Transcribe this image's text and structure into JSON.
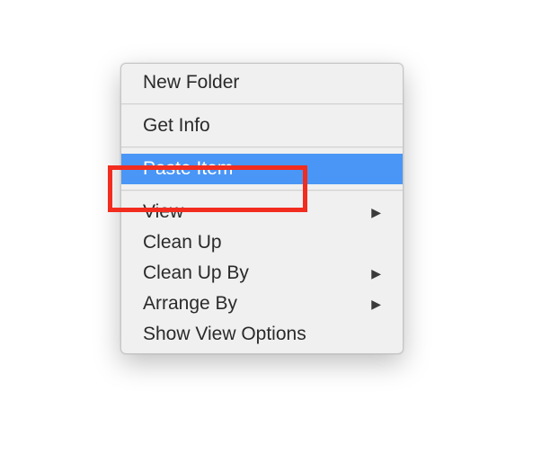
{
  "menu": {
    "items": [
      {
        "label": "New Folder",
        "has_submenu": false
      },
      {
        "label": "Get Info",
        "has_submenu": false
      },
      {
        "label": "Paste Item",
        "has_submenu": false
      },
      {
        "label": "View",
        "has_submenu": true
      },
      {
        "label": "Clean Up",
        "has_submenu": false
      },
      {
        "label": "Clean Up By",
        "has_submenu": true
      },
      {
        "label": "Arrange By",
        "has_submenu": true
      },
      {
        "label": "Show View Options",
        "has_submenu": false
      }
    ],
    "highlighted_index": 2,
    "submenu_glyph": "▶"
  }
}
